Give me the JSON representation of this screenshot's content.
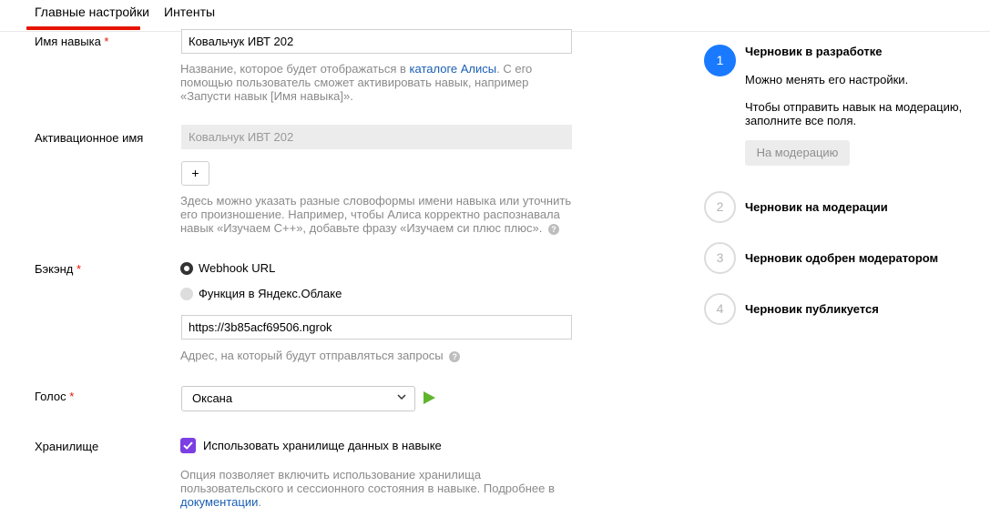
{
  "tabs": [
    {
      "label": "Главные настройки"
    },
    {
      "label": "Интенты"
    }
  ],
  "form": {
    "skill_name": {
      "label": "Имя навыка",
      "required": "*",
      "value": "Ковальчук ИВТ 202",
      "hint_before_link": "Название, которое будет отображаться в ",
      "hint_link": "каталоге Алисы",
      "hint_after_link": ". С его помощью пользователь сможет активировать навык, например «Запусти навык [Имя навыка]»."
    },
    "activation_name": {
      "label": "Активационное имя",
      "placeholder": "Ковальчук ИВТ 202",
      "add_label": "+",
      "hint": "Здесь можно указать разные словоформы имени навыка или уточнить его произношение. Например, чтобы Алиса корректно распознавала навык «Изучаем С++», добавьте фразу «Изучаем си плюс плюс»."
    },
    "backend": {
      "label": "Бэкэнд",
      "required": "*",
      "option_webhook": "Webhook URL",
      "option_function": "Функция в Яндекс.Облаке",
      "url_value": "https://3b85acf69506.ngrok",
      "hint": "Адрес, на который будут отправляться запросы"
    },
    "voice": {
      "label": "Голос",
      "required": "*",
      "selected": "Оксана"
    },
    "storage": {
      "label": "Хранилище",
      "checkbox_label": "Использовать хранилище данных в навыке",
      "hint_before_link": "Опция позволяет включить использование хранилища пользовательского и сессионного состояния в навыке. Подробнее в ",
      "hint_link": "документации",
      "hint_after_link": "."
    },
    "help_glyph": "?"
  },
  "stepper": {
    "steps": [
      {
        "number": "1",
        "title": "Черновик в разработке"
      },
      {
        "number": "2",
        "title": "Черновик на модерации"
      },
      {
        "number": "3",
        "title": "Черновик одобрен модератором"
      },
      {
        "number": "4",
        "title": "Черновик публикуется"
      }
    ],
    "step1_text1": "Можно менять его настройки.",
    "step1_text2": "Чтобы отправить навык на модерацию, заполните все поля.",
    "moderation_button": "На модерацию"
  },
  "colors": {
    "accent_red": "#e61400",
    "active_step": "#1a7aff",
    "link": "#1a5fb4",
    "checkbox": "#7b3fe4",
    "play": "#5fb52c"
  }
}
